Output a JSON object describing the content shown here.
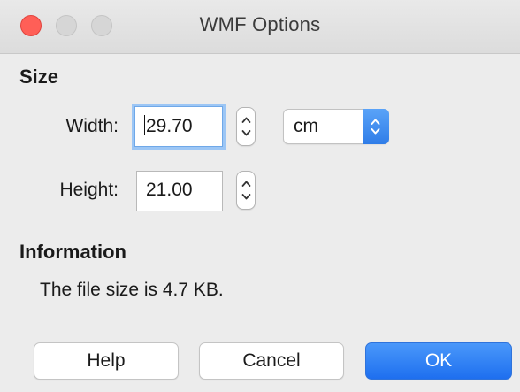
{
  "window": {
    "title": "WMF Options",
    "controls": [
      "close-button",
      "minimize-button",
      "zoom-button"
    ]
  },
  "size_section": {
    "heading": "Size",
    "width": {
      "label": "Width:",
      "value": "29.70"
    },
    "height": {
      "label": "Height:",
      "value": "21.00"
    },
    "unit": {
      "selected": "cm"
    }
  },
  "information_section": {
    "heading": "Information",
    "text": "The file size is 4.7 KB."
  },
  "buttons": {
    "help": "Help",
    "cancel": "Cancel",
    "ok": "OK"
  },
  "colors": {
    "close": "#ff5f57",
    "accent": "#2f7de8",
    "focus_ring": "#9cc6f5"
  }
}
